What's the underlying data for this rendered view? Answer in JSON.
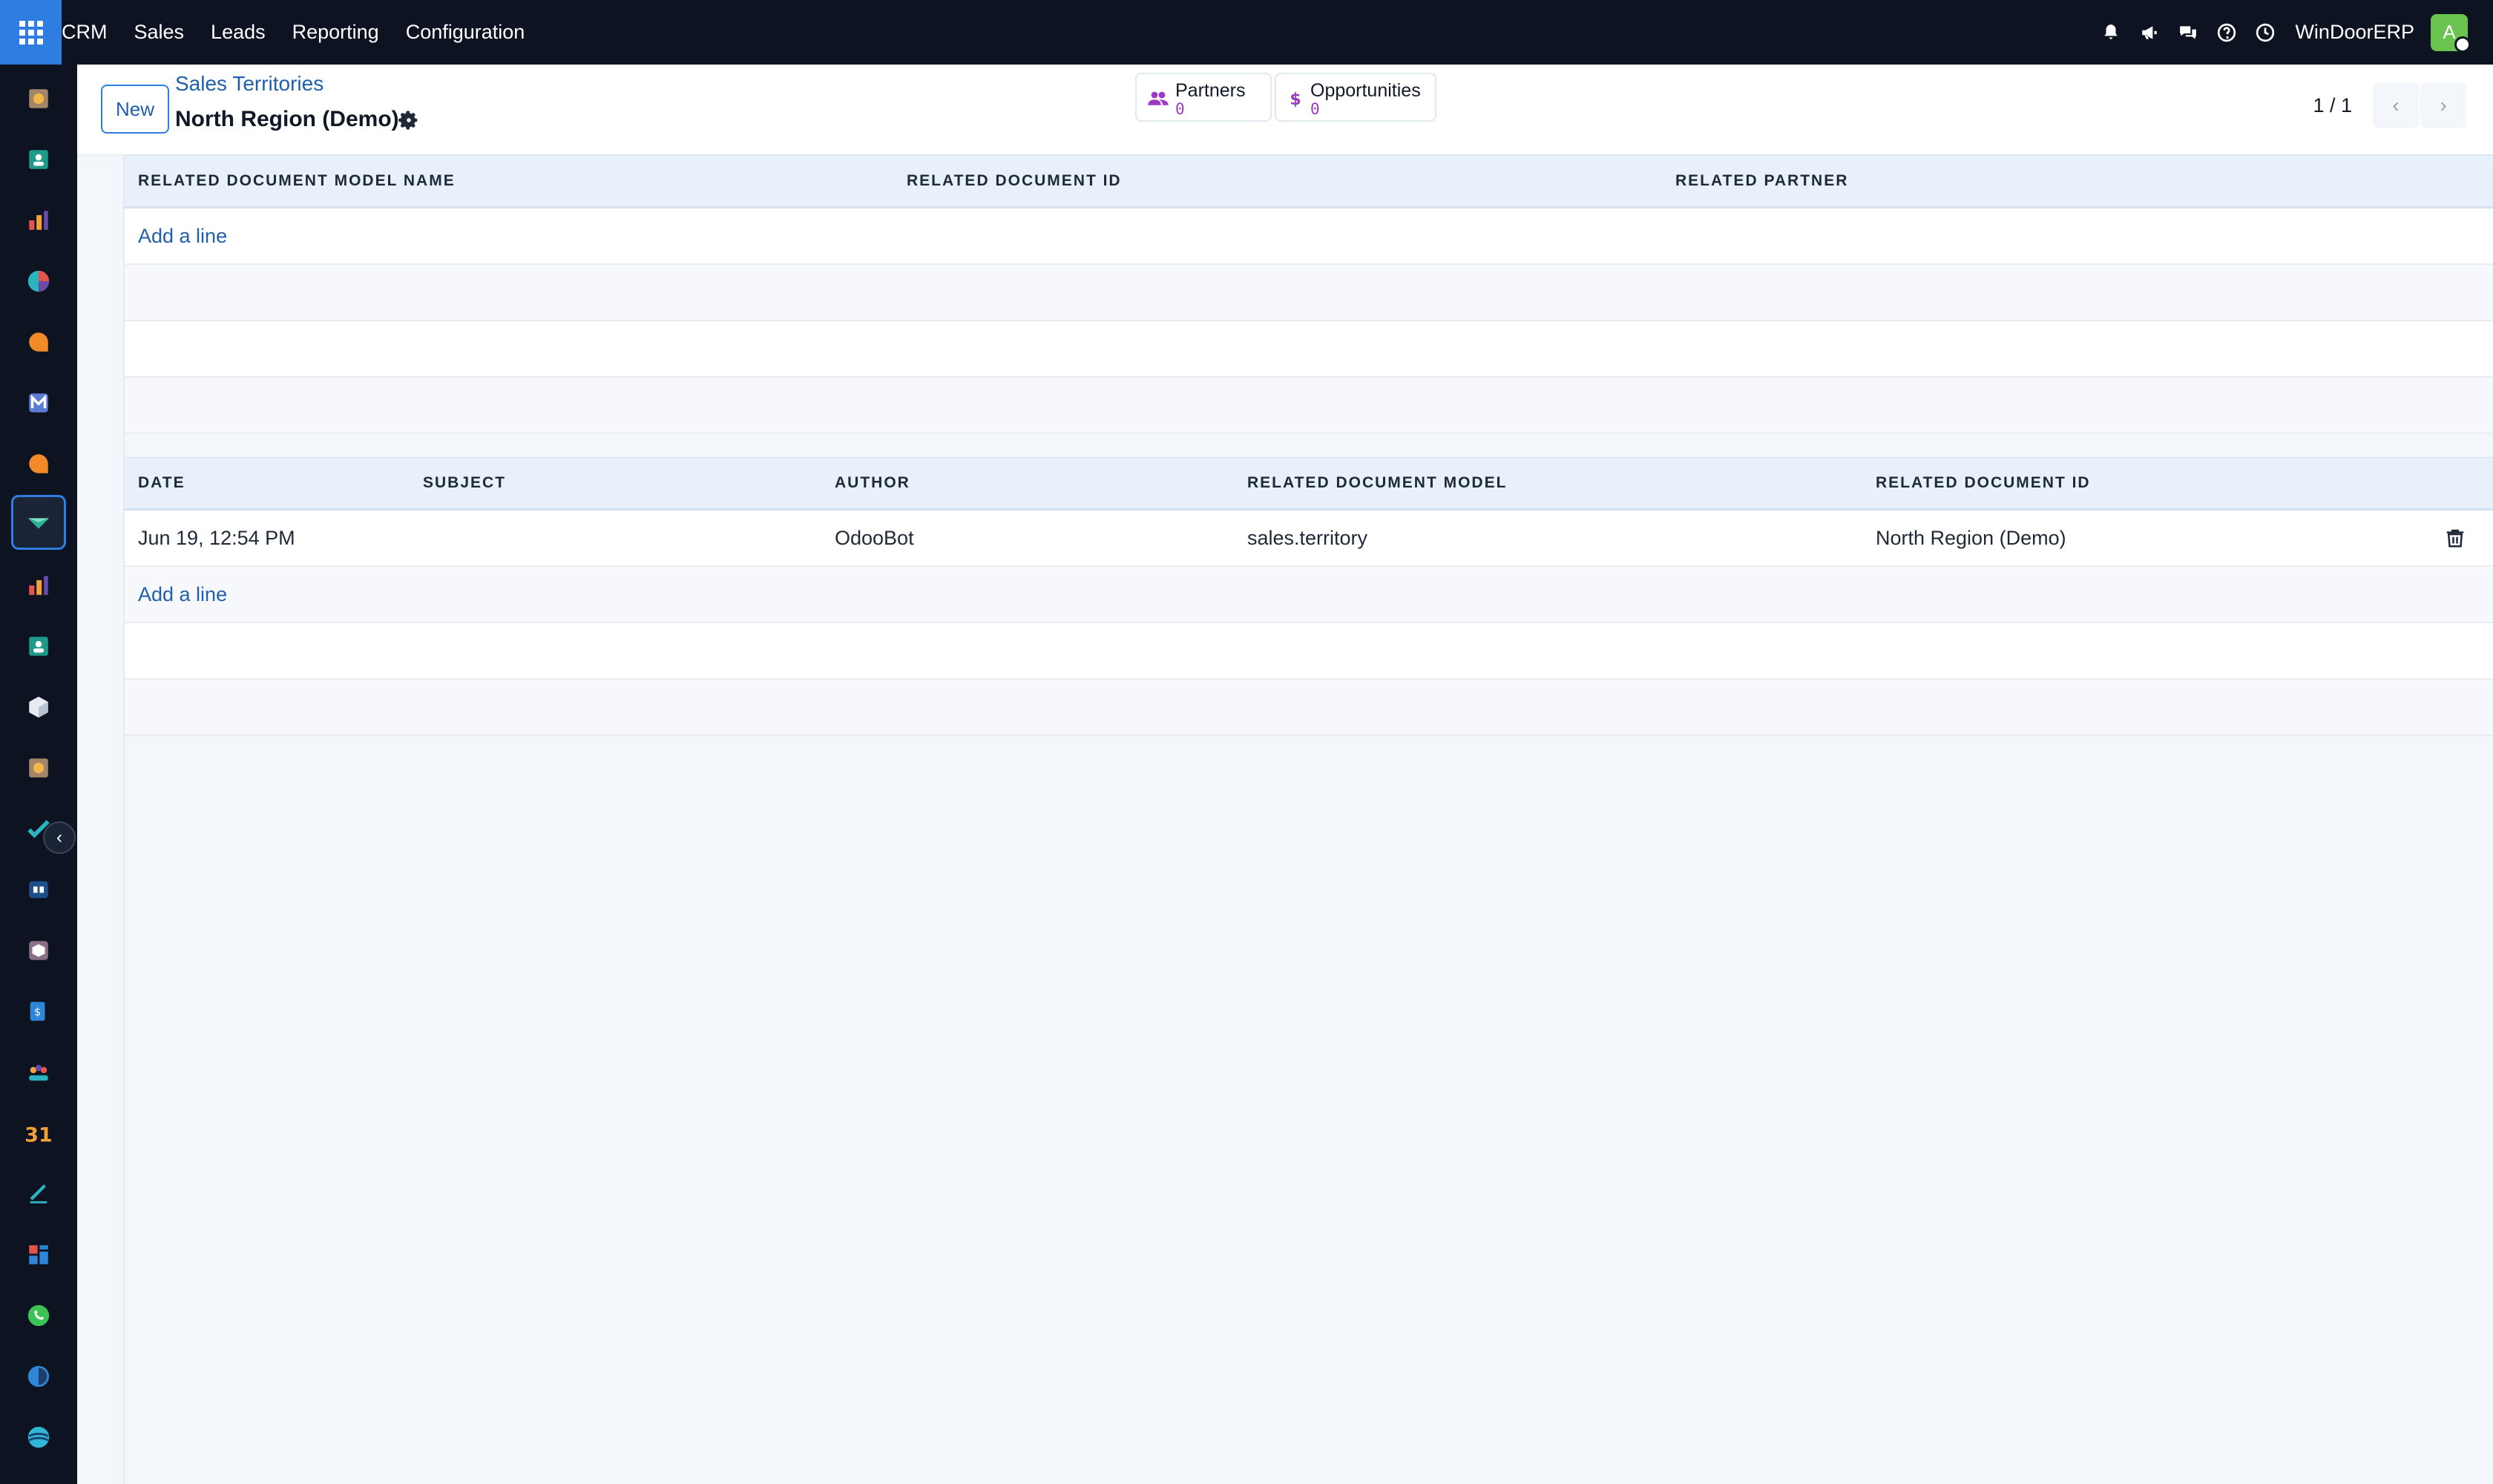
{
  "topbar": {
    "brand": "CRM",
    "menu": [
      "Sales",
      "Leads",
      "Reporting",
      "Configuration"
    ],
    "company": "WinDoorERP",
    "avatar_letter": "A",
    "icons": [
      "bell-icon",
      "megaphone-icon",
      "chat-icon",
      "help-icon",
      "clock-icon"
    ]
  },
  "sidebar": {
    "apps": [
      "sticky-note-app-icon",
      "contacts-app-icon",
      "reporting-app-icon",
      "dashboard-app-icon",
      "discuss-app-icon",
      "email-marketing-app-icon",
      "livechat-app-icon",
      "crm-app-icon",
      "sales-app-icon",
      "employees-app-icon",
      "inventory-app-icon",
      "notes-app-icon",
      "project-app-icon",
      "knowledge-app-icon",
      "purchase-app-icon",
      "expenses-app-icon",
      "community-app-icon",
      "calendar-app-icon",
      "sign-app-icon",
      "website-app-icon",
      "whatsapp-app-icon",
      "time-off-app-icon",
      "planning-app-icon"
    ]
  },
  "control": {
    "new_label": "New",
    "breadcrumb": "Sales Territories",
    "title": "North Region (Demo)",
    "stats": [
      {
        "label": "Partners",
        "count": "0",
        "icon": "users-icon"
      },
      {
        "label": "Opportunities",
        "count": "0",
        "icon": "dollar-icon"
      }
    ],
    "pager": "1 / 1"
  },
  "related_docs": {
    "headers": [
      "RELATED DOCUMENT MODEL NAME",
      "RELATED DOCUMENT ID",
      "RELATED PARTNER"
    ],
    "add_line": "Add a line"
  },
  "messages": {
    "headers": [
      "DATE",
      "SUBJECT",
      "AUTHOR",
      "RELATED DOCUMENT MODEL",
      "RELATED DOCUMENT ID"
    ],
    "rows": [
      {
        "date": "Jun 19, 12:54 PM",
        "subject": "",
        "author": "OdooBot",
        "model": "sales.territory",
        "record": "North Region (Demo)"
      }
    ],
    "add_line": "Add a line"
  },
  "colors": {
    "topbar": "#0d1321",
    "accent": "#2f7de1",
    "link": "#1f5fae",
    "stat_count": "#9b3bc4"
  }
}
